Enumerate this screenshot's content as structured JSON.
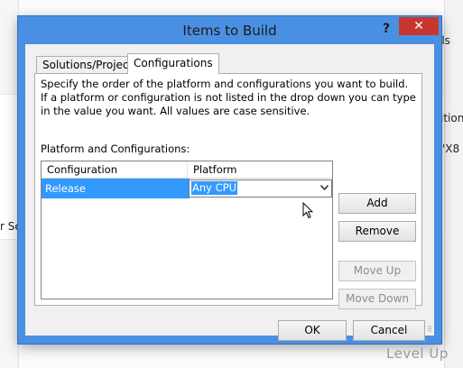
{
  "background": {
    "right_top": "ils",
    "right_mid": "ition",
    "right_x": "'X8",
    "left_mid": "r Se"
  },
  "dialog": {
    "title": "Items to Build",
    "help_label": "?",
    "close_label": "✕"
  },
  "tabs": [
    {
      "label": "Solutions/Projects",
      "active": false
    },
    {
      "label": "Configurations",
      "active": true
    }
  ],
  "panel": {
    "description": "Specify the order of the platform and configurations you want to build. If a platform or configuration is not listed in the drop down you can type in the value you want. All values are case sensitive.",
    "list_label": "Platform and Configurations:",
    "columns": [
      "Configuration",
      "Platform"
    ],
    "rows": [
      {
        "configuration": "Release",
        "platform": "Any CPU"
      }
    ]
  },
  "side_buttons": {
    "add": "Add",
    "remove": "Remove",
    "move_up": "Move Up",
    "move_down": "Move Down"
  },
  "footer_buttons": {
    "ok": "OK",
    "cancel": "Cancel"
  },
  "watermark": "Level Up",
  "colors": {
    "accent": "#4a90e2",
    "selection": "#3399ff",
    "close": "#c7372f"
  }
}
